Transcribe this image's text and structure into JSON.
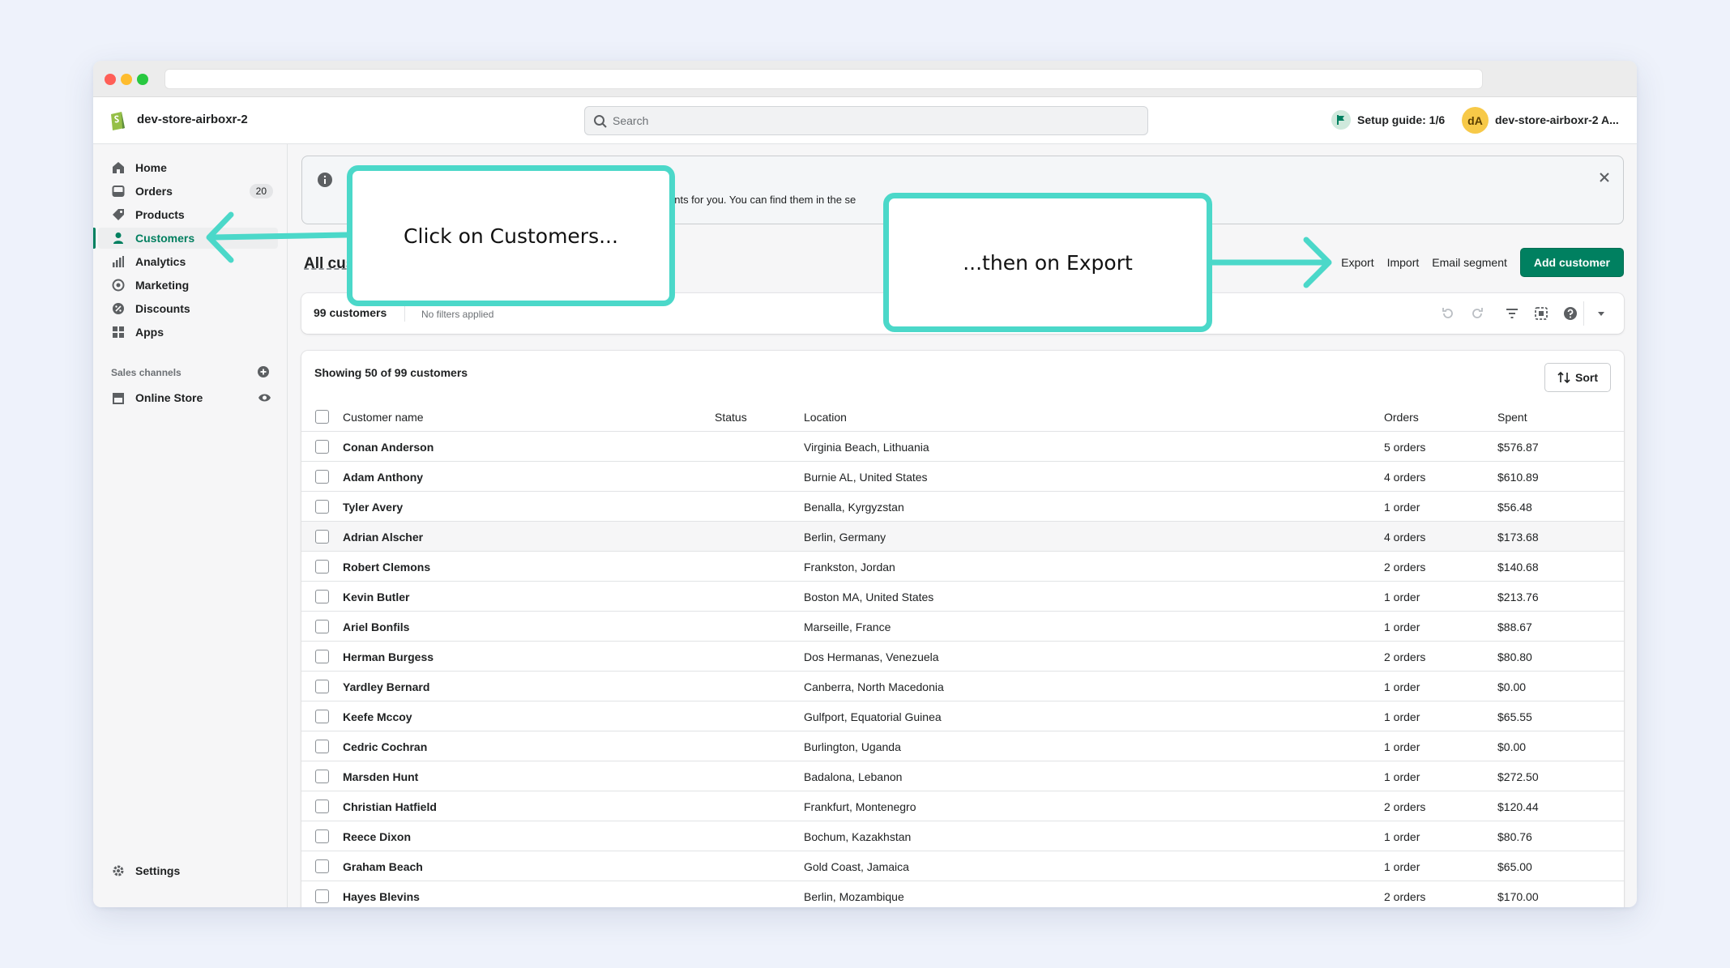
{
  "header": {
    "store_name": "dev-store-airboxr-2",
    "search_placeholder": "Search",
    "setup_guide": "Setup guide: 1/6",
    "avatar_initials": "dA",
    "account_name": "dev-store-airboxr-2 A..."
  },
  "sidebar": {
    "items": [
      {
        "label": "Home",
        "icon": "home-icon"
      },
      {
        "label": "Orders",
        "icon": "orders-icon",
        "badge": "20"
      },
      {
        "label": "Products",
        "icon": "tag-icon"
      },
      {
        "label": "Customers",
        "icon": "person-icon",
        "active": true
      },
      {
        "label": "Analytics",
        "icon": "bar-chart-icon"
      },
      {
        "label": "Marketing",
        "icon": "target-icon"
      },
      {
        "label": "Discounts",
        "icon": "discount-icon"
      },
      {
        "label": "Apps",
        "icon": "apps-grid-icon"
      }
    ],
    "sales_channels_label": "Sales channels",
    "online_store": "Online Store",
    "settings": "Settings"
  },
  "banner": {
    "text": "ents for you. You can find them in the se"
  },
  "page": {
    "title": "All cus",
    "actions": {
      "export": "Export",
      "import": "Import",
      "email_segment": "Email segment",
      "add_customer": "Add customer"
    }
  },
  "filterbar": {
    "count": "99 customers",
    "filters": "No filters applied"
  },
  "table": {
    "showing": "Showing 50 of 99 customers",
    "sort_label": "Sort",
    "columns": {
      "name": "Customer name",
      "status": "Status",
      "location": "Location",
      "orders": "Orders",
      "spent": "Spent"
    },
    "rows": [
      {
        "name": "Conan Anderson",
        "location": "Virginia Beach, Lithuania",
        "orders": "5 orders",
        "spent": "$576.87"
      },
      {
        "name": "Adam Anthony",
        "location": "Burnie AL, United States",
        "orders": "4 orders",
        "spent": "$610.89"
      },
      {
        "name": "Tyler Avery",
        "location": "Benalla, Kyrgyzstan",
        "orders": "1 order",
        "spent": "$56.48"
      },
      {
        "name": "Adrian Alscher",
        "location": "Berlin, Germany",
        "orders": "4 orders",
        "spent": "$173.68",
        "highlight": true
      },
      {
        "name": "Robert Clemons",
        "location": "Frankston, Jordan",
        "orders": "2 orders",
        "spent": "$140.68"
      },
      {
        "name": "Kevin Butler",
        "location": "Boston MA, United States",
        "orders": "1 order",
        "spent": "$213.76"
      },
      {
        "name": "Ariel Bonfils",
        "location": "Marseille, France",
        "orders": "1 order",
        "spent": "$88.67"
      },
      {
        "name": "Herman Burgess",
        "location": "Dos Hermanas, Venezuela",
        "orders": "2 orders",
        "spent": "$80.80"
      },
      {
        "name": "Yardley Bernard",
        "location": "Canberra, North Macedonia",
        "orders": "1 order",
        "spent": "$0.00"
      },
      {
        "name": "Keefe Mccoy",
        "location": "Gulfport, Equatorial Guinea",
        "orders": "1 order",
        "spent": "$65.55"
      },
      {
        "name": "Cedric Cochran",
        "location": "Burlington, Uganda",
        "orders": "1 order",
        "spent": "$0.00"
      },
      {
        "name": "Marsden Hunt",
        "location": "Badalona, Lebanon",
        "orders": "1 order",
        "spent": "$272.50"
      },
      {
        "name": "Christian Hatfield",
        "location": "Frankfurt, Montenegro",
        "orders": "2 orders",
        "spent": "$120.44"
      },
      {
        "name": "Reece Dixon",
        "location": "Bochum, Kazakhstan",
        "orders": "1 order",
        "spent": "$80.76"
      },
      {
        "name": "Graham Beach",
        "location": "Gold Coast, Jamaica",
        "orders": "1 order",
        "spent": "$65.00"
      },
      {
        "name": "Hayes Blevins",
        "location": "Berlin, Mozambique",
        "orders": "2 orders",
        "spent": "$170.00"
      }
    ]
  },
  "annotations": {
    "callout1": "Click on Customers...",
    "callout2": "...then on Export",
    "color": "#4bd8c9"
  }
}
